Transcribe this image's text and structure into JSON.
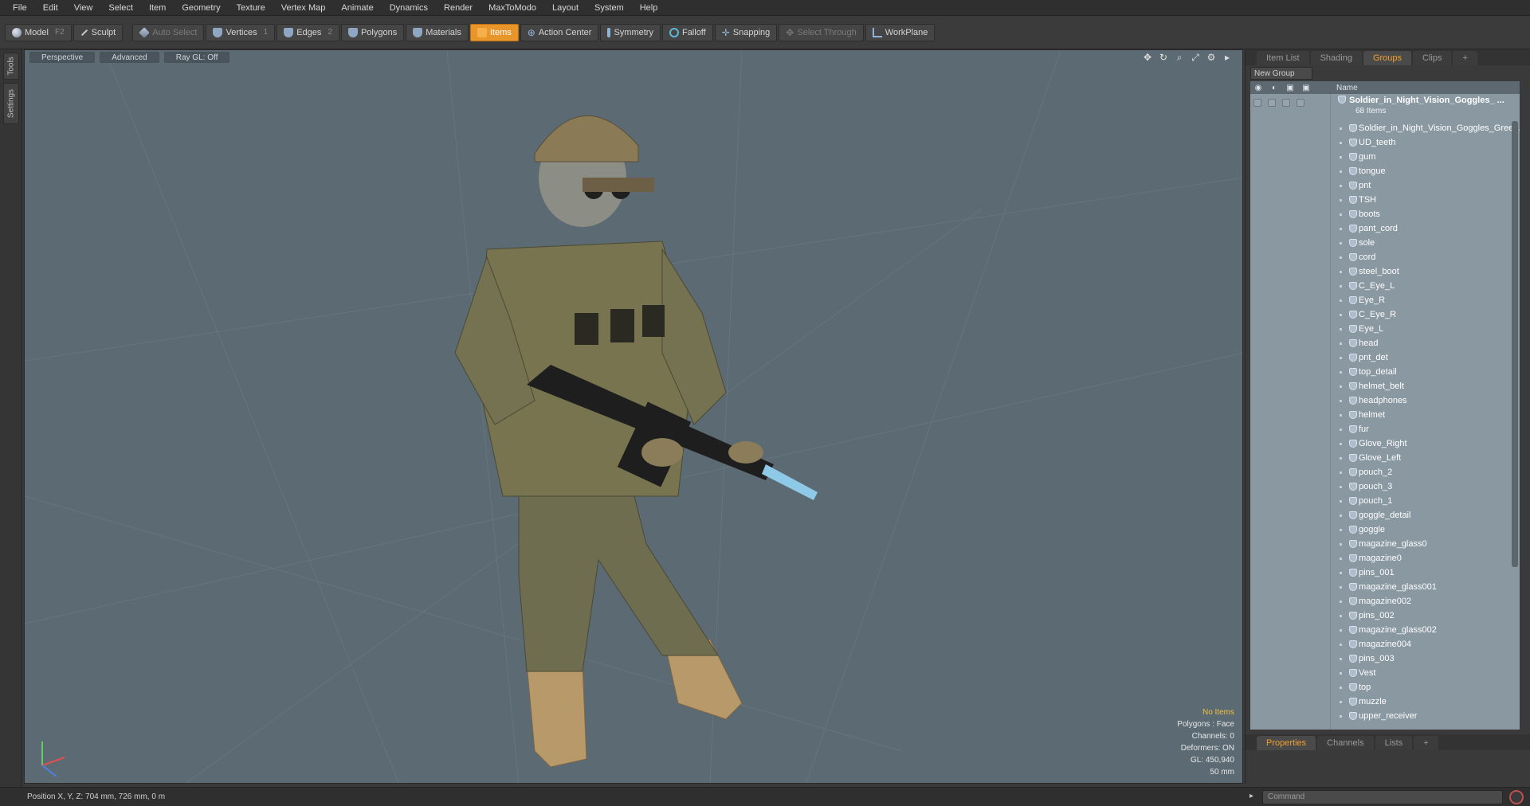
{
  "menu": [
    "File",
    "Edit",
    "View",
    "Select",
    "Item",
    "Geometry",
    "Texture",
    "Vertex Map",
    "Animate",
    "Dynamics",
    "Render",
    "MaxToModo",
    "Layout",
    "System",
    "Help"
  ],
  "toolbar": {
    "model": "Model",
    "model_key": "F2",
    "sculpt": "Sculpt",
    "auto_select": "Auto Select",
    "vertices": "Vertices",
    "vertices_key": "1",
    "edges": "Edges",
    "edges_key": "2",
    "polygons": "Polygons",
    "materials": "Materials",
    "items": "Items",
    "action_center": "Action Center",
    "symmetry": "Symmetry",
    "falloff": "Falloff",
    "snapping": "Snapping",
    "select_through": "Select Through",
    "workplane": "WorkPlane"
  },
  "left_tabs": [
    "Tools",
    "Settings"
  ],
  "viewport": {
    "view": "Perspective",
    "mode": "Advanced",
    "raygl": "Ray GL: Off",
    "info": {
      "selection": "No Items",
      "polygons": "Polygons : Face",
      "channels": "Channels: 0",
      "deformers": "Deformers: ON",
      "gl": "GL: 450,940",
      "lens": "50 mm"
    }
  },
  "right_panel": {
    "tabs": [
      "Item List",
      "Shading",
      "Groups",
      "Clips",
      "+"
    ],
    "active_tab": "Groups",
    "new_group": "New Group",
    "tree_header": "Name",
    "root": {
      "name": "Soldier_in_Night_Vision_Goggles_ ...",
      "count": "68 Items"
    },
    "items": [
      "Soldier_in_Night_Vision_Goggles_Gree...",
      "UD_teeth",
      "gum",
      "tongue",
      "pnt",
      "TSH",
      "boots",
      "pant_cord",
      "sole",
      "cord",
      "steel_boot",
      "C_Eye_L",
      "Eye_R",
      "C_Eye_R",
      "Eye_L",
      "head",
      "pnt_det",
      "top_detail",
      "helmet_belt",
      "headphones",
      "helmet",
      "fur",
      "Glove_Right",
      "Glove_Left",
      "pouch_2",
      "pouch_3",
      "pouch_1",
      "goggle_detail",
      "goggle",
      "magazine_glass0",
      "magazine0",
      "pins_001",
      "magazine_glass001",
      "magazine002",
      "pins_002",
      "magazine_glass002",
      "magazine004",
      "pins_003",
      "Vest",
      "top",
      "muzzle",
      "upper_receiver"
    ],
    "bottom_tabs": [
      "Properties",
      "Channels",
      "Lists",
      "+"
    ],
    "bottom_active": "Properties"
  },
  "status": {
    "position": "Position X, Y, Z:   704 mm, 726 mm, 0 m",
    "command_placeholder": "Command"
  },
  "colors": {
    "accent": "#e8962a",
    "viewport_bg": "#5b6a73",
    "tree_bg": "#8a98a2"
  }
}
